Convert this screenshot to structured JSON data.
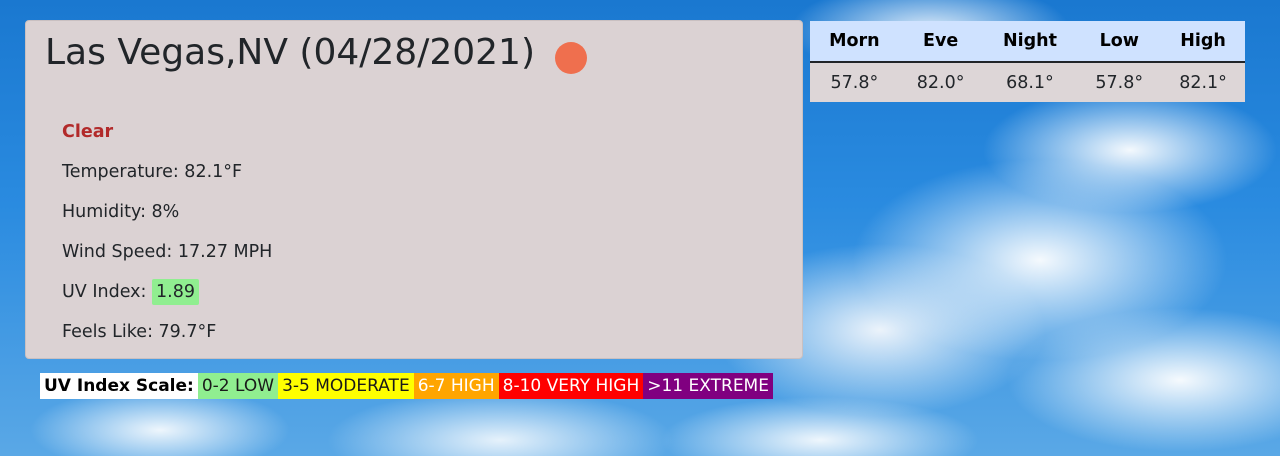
{
  "current": {
    "title": "Las Vegas,NV (04/28/2021)",
    "icon": "sun-icon",
    "condition": "Clear",
    "temperature": "Temperature: 82.1°F",
    "humidity": "Humidity: 8%",
    "wind_speed": "Wind Speed: 17.27 MPH",
    "uv_label": "UV Index:",
    "uv_value": "1.89",
    "feels_like": "Feels Like: 79.7°F"
  },
  "forecast": {
    "headers": [
      "Morn",
      "Eve",
      "Night",
      "Low",
      "High"
    ],
    "values": [
      "57.8°",
      "82.0°",
      "68.1°",
      "57.8°",
      "82.1°"
    ]
  },
  "uv_scale": {
    "label": "UV Index Scale:",
    "segments": [
      "0-2 LOW",
      "3-5 MODERATE",
      "6-7 HIGH",
      "8-10 VERY HIGH",
      ">11 EXTREME"
    ],
    "colors": [
      "#90ee90",
      "#ffff00",
      "#ffa500",
      "#ff0000",
      "#800080"
    ]
  },
  "colors": {
    "card_bg": "#dbd2d3",
    "condition_text": "#b22a2a",
    "icon": "#ef6f4e",
    "table_header_bg": "#cfe2ff"
  }
}
